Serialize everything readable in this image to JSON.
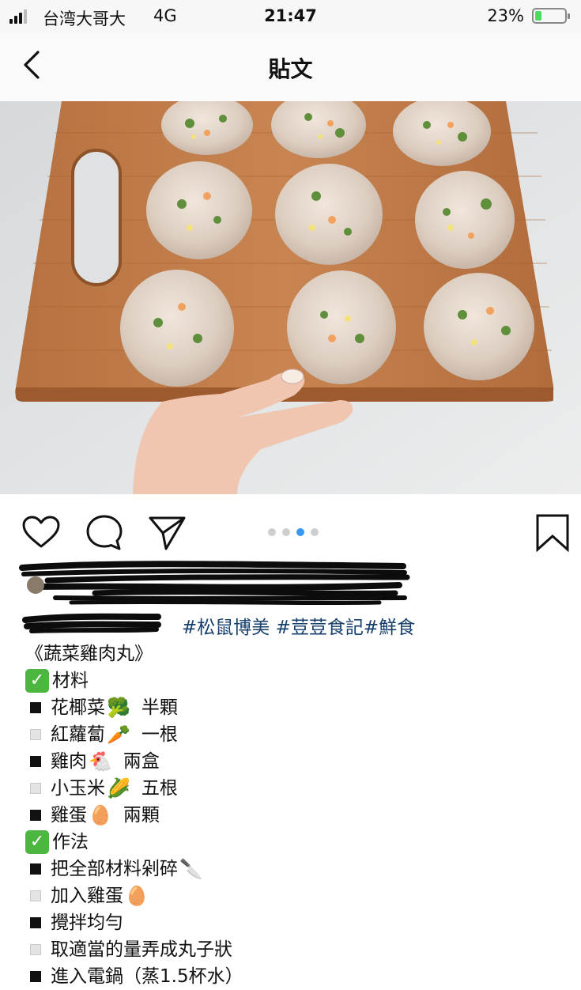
{
  "status_bar": {
    "carrier": "台湾大哥大",
    "network": "4G",
    "time": "21:47",
    "battery_percent": "23%",
    "battery_level": 0.23
  },
  "nav": {
    "title": "貼文"
  },
  "post": {
    "carousel_total": 4,
    "carousel_active": 3,
    "visible_fragment": "#松鼠博美 #荳荳食記#鮮食",
    "caption": {
      "title": "《蔬菜雞肉丸》",
      "ingredients_heading": "材料",
      "ingredients": [
        {
          "name": "花椰菜",
          "emoji": "🥦",
          "qty": "半顆"
        },
        {
          "name": "紅蘿蔔",
          "emoji": "🥕",
          "qty": "一根"
        },
        {
          "name": "雞肉",
          "emoji": "🐔",
          "qty": "兩盒"
        },
        {
          "name": "小玉米",
          "emoji": "🌽",
          "qty": "五根"
        },
        {
          "name": "雞蛋",
          "emoji": "🥚",
          "qty": "兩顆"
        }
      ],
      "steps_heading": "作法",
      "steps": [
        {
          "text": "把全部材料剁碎",
          "emoji": "🔪"
        },
        {
          "text": "加入雞蛋",
          "emoji": "🥚"
        },
        {
          "text": "攪拌均勻",
          "emoji": ""
        },
        {
          "text": "取適當的量弄成丸子狀",
          "emoji": ""
        },
        {
          "text": "進入電鍋（蒸1.5杯水）",
          "emoji": ""
        }
      ]
    }
  },
  "colors": {
    "link": "#163f6c",
    "active_dot": "#3897f0",
    "battery_fill": "#4cd964",
    "check": "#4cb641"
  }
}
